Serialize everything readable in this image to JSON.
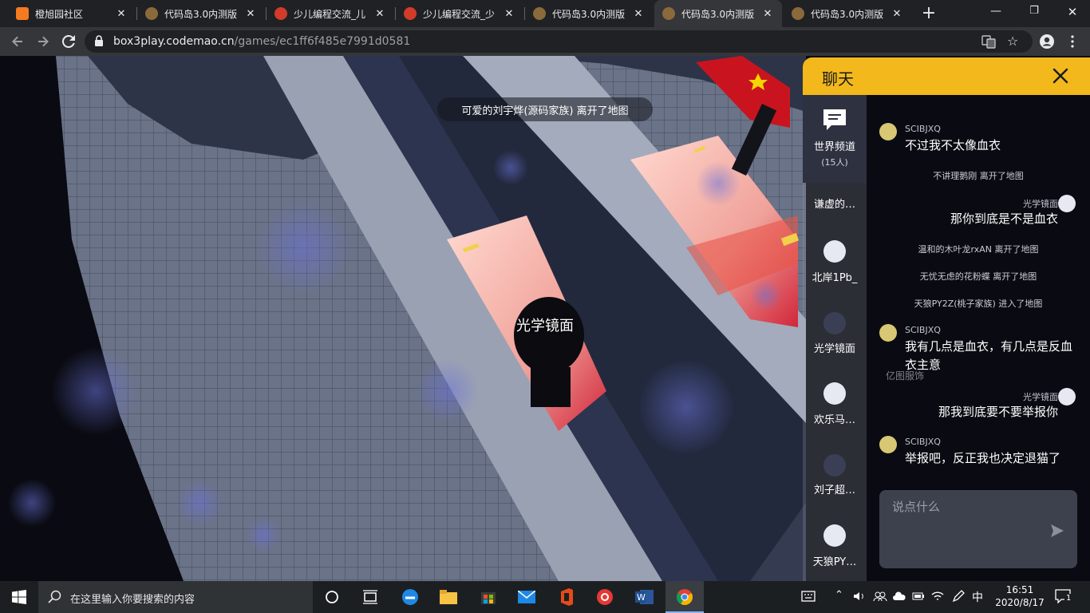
{
  "browser": {
    "tabs": [
      {
        "title": "橙旭园社区",
        "favicon": "orange-app-icon"
      },
      {
        "title": "代码岛3.0内测版",
        "favicon": "codemao-icon"
      },
      {
        "title": "少儿编程交流_儿",
        "favicon": "tieba-icon"
      },
      {
        "title": "少儿编程交流_少",
        "favicon": "tieba-icon"
      },
      {
        "title": "代码岛3.0内测版",
        "favicon": "codemao-icon"
      },
      {
        "title": "代码岛3.0内测版",
        "favicon": "codemao-icon",
        "active": true
      },
      {
        "title": "代码岛3.0内测版",
        "favicon": "codemao-icon"
      }
    ],
    "new_tab_label": "+",
    "url_host": "box3play.codemao.cn",
    "url_path": "/games/ec1ff6f485e7991d0581"
  },
  "game": {
    "toast": "可爱的刘宇烨(源码家族) 离开了地图",
    "player_name": "光学镜面",
    "watermark": "亿图服饰"
  },
  "chat": {
    "title": "聊天",
    "channel": {
      "name": "世界频道",
      "count": "(15人)"
    },
    "contacts": [
      {
        "name": "谦虚的…"
      },
      {
        "name": "北岸1Pb_"
      },
      {
        "name": "光学镜面"
      },
      {
        "name": "欢乐马…"
      },
      {
        "name": "刘子超…"
      },
      {
        "name": "天狼PY…"
      }
    ],
    "messages": [
      {
        "kind": "left",
        "name": "SCIBJXQ",
        "text": "不过我不太像血衣"
      },
      {
        "kind": "system",
        "text": "不讲理鹅刚 离开了地图"
      },
      {
        "kind": "right",
        "name": "光学镜面",
        "text": "那你到底是不是血衣"
      },
      {
        "kind": "system",
        "text": "温和的木叶龙rxAN 离开了地图"
      },
      {
        "kind": "system",
        "text": "无忧无虑的花粉蝶 离开了地图"
      },
      {
        "kind": "system",
        "text": "天狼PY2Z(桃子家族) 进入了地图"
      },
      {
        "kind": "left",
        "name": "SCIBJXQ",
        "text": "我有几点是血衣，有几点是反血衣主意"
      },
      {
        "kind": "right",
        "name": "光学镜面",
        "text": "那我到底要不要举报你"
      },
      {
        "kind": "left",
        "name": "SCIBJXQ",
        "text": "举报吧，反正我也决定退猫了"
      }
    ],
    "input_placeholder": "说点什么"
  },
  "taskbar": {
    "search_placeholder": "在这里输入你要搜索的内容",
    "time": "16:51",
    "date": "2020/8/17",
    "ime": "中",
    "notification_count": "1"
  },
  "colors": {
    "chat_header": "#f2b81c",
    "browser_bg": "#202124",
    "toolbar_bg": "#35363a"
  }
}
